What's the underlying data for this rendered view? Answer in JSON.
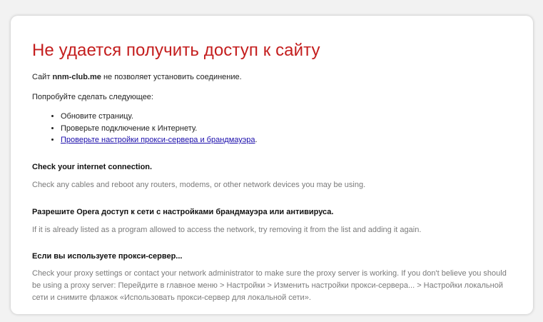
{
  "error": {
    "title": "Не удается получить доступ к сайту",
    "line1_prefix": "Сайт ",
    "site": "nnm-club.me",
    "line1_suffix": " не позволяет установить соединение.",
    "try_label": "Попробуйте сделать следующее:",
    "suggestions": [
      "Обновите страницу.",
      "Проверьте подключение к Интернету."
    ],
    "proxy_link": "Проверьте настройки прокси-сервера и брандмауэра",
    "proxy_link_suffix": "."
  },
  "sections": [
    {
      "heading": "Check your internet connection.",
      "text": "Check any cables and reboot any routers, modems, or other network devices you may be using."
    },
    {
      "heading": "Разрешите Opera доступ к сети с настройками брандмауэра или антивируса.",
      "text": "If it is already listed as a program allowed to access the network, try removing it from the list and adding it again."
    },
    {
      "heading": "Если вы используете прокси-сервер...",
      "text": "Check your proxy settings or contact your network administrator to make sure the proxy server is working. If you don't believe you should be using a proxy server: Перейдите в главное меню > Настройки > Изменить настройки прокси-сервера... > Настройки локальной сети и снимите флажок «Использовать прокси-сервер для локальной сети»."
    }
  ],
  "colors": {
    "title": "#c41e1e",
    "link": "#1a0dab",
    "muted_text": "#7a7a7a",
    "page_background": "#f2f2f2",
    "card_background": "#ffffff"
  }
}
